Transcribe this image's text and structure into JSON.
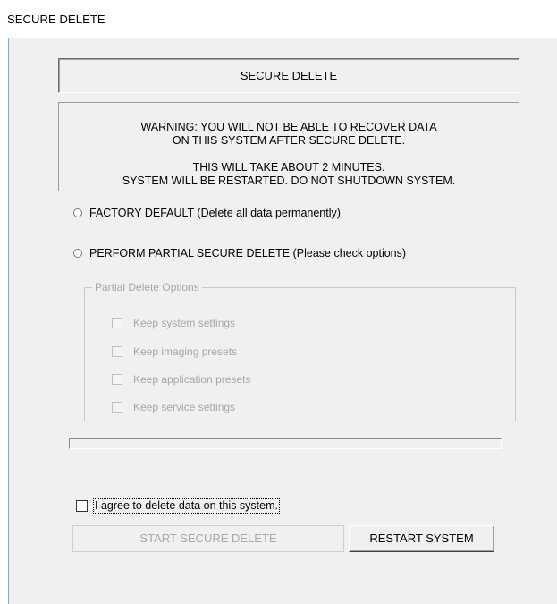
{
  "window": {
    "title": "SECURE DELETE"
  },
  "header": {
    "title": "SECURE DELETE"
  },
  "warning": {
    "line1": "WARNING: YOU WILL NOT BE ABLE TO RECOVER DATA",
    "line2": "ON THIS SYSTEM AFTER SECURE DELETE.",
    "line3": "THIS WILL TAKE ABOUT 2 MINUTES.",
    "line4": "SYSTEM WILL BE RESTARTED. DO NOT SHUTDOWN SYSTEM."
  },
  "options": {
    "factory_default": "FACTORY DEFAULT (Delete all data permanently)",
    "partial": "PERFORM PARTIAL SECURE DELETE (Please check options)"
  },
  "partial_group": {
    "legend": "Partial Delete Options",
    "items": [
      {
        "label": "Keep system settings"
      },
      {
        "label": "Keep imaging presets"
      },
      {
        "label": "Keep application presets"
      },
      {
        "label": "Keep service settings"
      }
    ]
  },
  "progress": {
    "value": 0
  },
  "agree": {
    "label": "I agree to delete data on this system."
  },
  "buttons": {
    "start": "START SECURE DELETE",
    "restart": "RESTART SYSTEM"
  }
}
